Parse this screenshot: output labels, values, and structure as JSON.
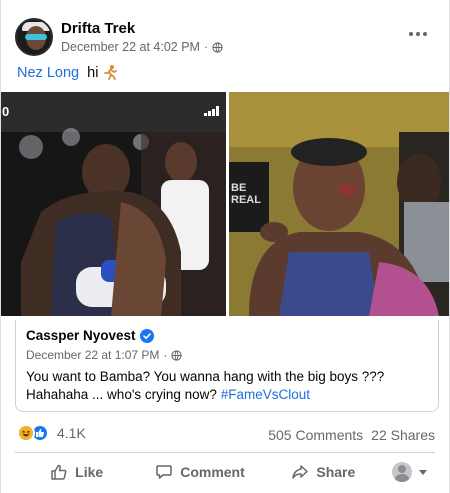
{
  "post": {
    "author": "Drifta Trek",
    "timestamp": "December 22 at 4:02 PM",
    "separator": "·",
    "mention": "Nez Long",
    "text": "hi",
    "privacy_icon": "globe-icon"
  },
  "media": {
    "left_overlay": "0",
    "right_overlay_line1": "BE",
    "right_overlay_line2": "REAL"
  },
  "shared_post": {
    "author": "Cassper Nyovest",
    "timestamp": "December 22 at 1:07 PM",
    "separator": "·",
    "text": "You want to Bamba? You wanna hang with the big boys ??? Hahahaha ... who's crying now? ",
    "hashtag": "#FameVsClout"
  },
  "engagement": {
    "reaction_count": "4.1K",
    "comments": "505 Comments",
    "shares": "22 Shares"
  },
  "actions": {
    "like": "Like",
    "comment": "Comment",
    "share": "Share"
  },
  "colors": {
    "link": "#216fdb",
    "muted": "#65676b",
    "like_blue": "#1877f2",
    "haha_yellow": "#f7b125"
  }
}
